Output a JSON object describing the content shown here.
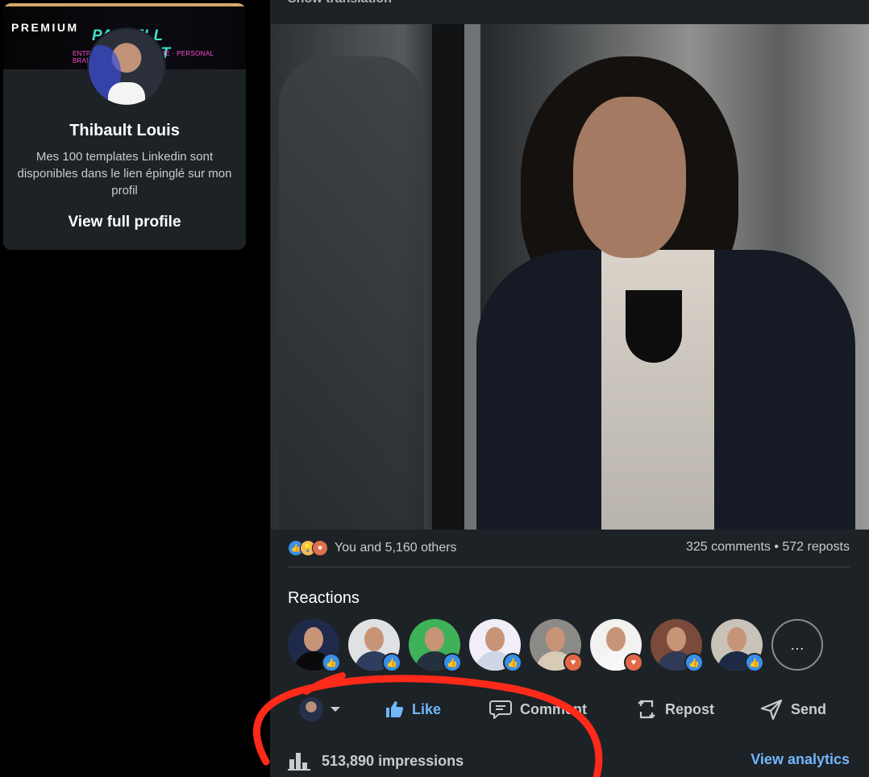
{
  "profile_card": {
    "badge": "PREMIUM",
    "banner_title": "PASTELL THIBAULT",
    "banner_subtitle": "ENTREPRENEUR · ÉCRITURE · PERSONAL BRANDING",
    "name": "Thibault Louis",
    "bio": "Mes 100 templates Linkedin sont disponibles dans le lien épinglé sur mon profil",
    "view_profile": "View full profile"
  },
  "post": {
    "show_translation": "Show translation",
    "reactions_summary": "You and 5,160 others",
    "comments_reposts": "325 comments • 572 reposts",
    "reaction_icons": [
      "like-icon",
      "insightful-icon",
      "love-icon"
    ],
    "reactions_heading": "Reactions",
    "reactors": [
      {
        "badge": "like",
        "bg": "#1f2a4a",
        "body": "#0a0a0c"
      },
      {
        "badge": "like",
        "bg": "#dfe1e3",
        "body": "#2f3d5e"
      },
      {
        "badge": "like",
        "bg": "#3fb259",
        "body": "#24303e"
      },
      {
        "badge": "like",
        "bg": "#f1eef7",
        "body": "#cfd6e5"
      },
      {
        "badge": "love",
        "bg": "#8c8a86",
        "body": "#d8cbb6"
      },
      {
        "badge": "love",
        "bg": "#f2f2f0",
        "body": "#f7f7f7"
      },
      {
        "badge": "like",
        "bg": "#7a4a3a",
        "body": "#2f3a56"
      },
      {
        "badge": "like",
        "bg": "#c9c2b8",
        "body": "#1e2a45"
      }
    ],
    "more_label": "…",
    "actions": {
      "like": "Like",
      "comment": "Comment",
      "repost": "Repost",
      "send": "Send"
    },
    "impressions": "513,890 impressions",
    "view_analytics": "View analytics"
  },
  "colors": {
    "like_blue": "#71b7fb",
    "love_red": "#e16745",
    "panel": "#1d2226",
    "annotation_red": "#ff2a1a"
  }
}
